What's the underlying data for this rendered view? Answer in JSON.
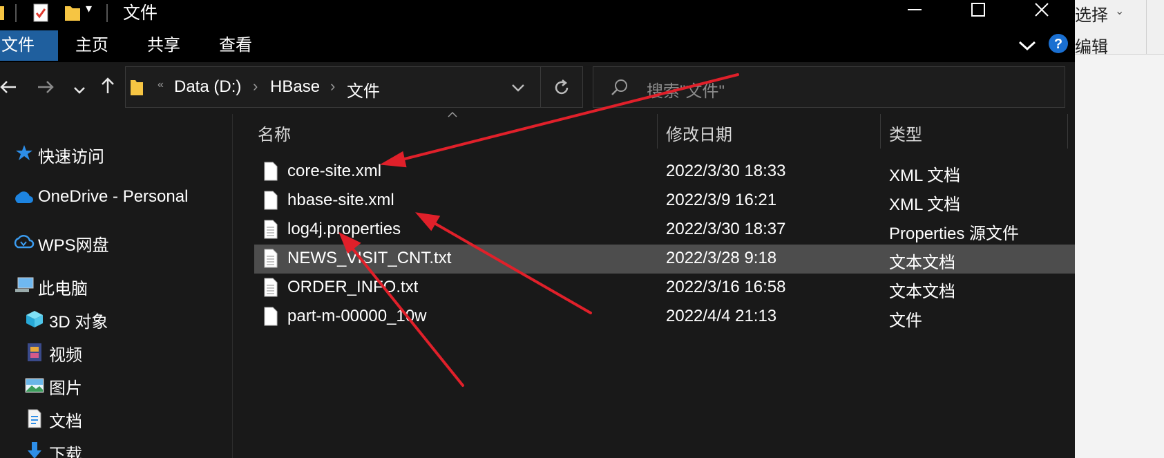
{
  "window": {
    "title": "文件",
    "controls": [
      "minimize",
      "maximize",
      "close"
    ]
  },
  "ribbon": {
    "tabs": [
      {
        "label": "文件",
        "active": true
      },
      {
        "label": "主页"
      },
      {
        "label": "共享"
      },
      {
        "label": "查看"
      }
    ]
  },
  "address": {
    "overflow": "«",
    "crumbs": [
      "Data (D:)",
      "HBase",
      "文件"
    ]
  },
  "search": {
    "placeholder": "搜索\"文件\""
  },
  "nav": {
    "items": [
      {
        "label": "快速访问",
        "icon": "star-icon"
      },
      {
        "label": "OneDrive - Personal",
        "icon": "cloud-icon"
      },
      {
        "label": "WPS网盘",
        "icon": "cloud-outline-icon"
      },
      {
        "label": "此电脑",
        "icon": "computer-icon"
      },
      {
        "label": "3D 对象",
        "icon": "cube-icon"
      },
      {
        "label": "视频",
        "icon": "film-icon"
      },
      {
        "label": "图片",
        "icon": "picture-icon"
      },
      {
        "label": "文档",
        "icon": "document-icon"
      },
      {
        "label": "下载",
        "icon": "download-icon"
      }
    ]
  },
  "columns": [
    "名称",
    "修改日期",
    "类型"
  ],
  "files": [
    {
      "name": "core-site.xml",
      "date": "2022/3/30 18:33",
      "type": "XML 文档"
    },
    {
      "name": "hbase-site.xml",
      "date": "2022/3/9 16:21",
      "type": "XML 文档"
    },
    {
      "name": "log4j.properties",
      "date": "2022/3/30 18:37",
      "type": "Properties 源文件"
    },
    {
      "name": "NEWS_VISIT_CNT.txt",
      "date": "2022/3/28 9:18",
      "type": "文本文档",
      "selected": true
    },
    {
      "name": "ORDER_INFO.txt",
      "date": "2022/3/16 16:58",
      "type": "文本文档"
    },
    {
      "name": "part-m-00000_10w",
      "date": "2022/4/4 21:13",
      "type": "文件"
    }
  ],
  "background_window": {
    "select_label": "选择",
    "edit_label": "编辑"
  },
  "colors": {
    "window_bg": "#191919",
    "titlebar_bg": "#000000",
    "active_tab": "#1f5f9e",
    "selected_row": "#4d4d4d",
    "annotation_arrow": "#e0202a"
  }
}
